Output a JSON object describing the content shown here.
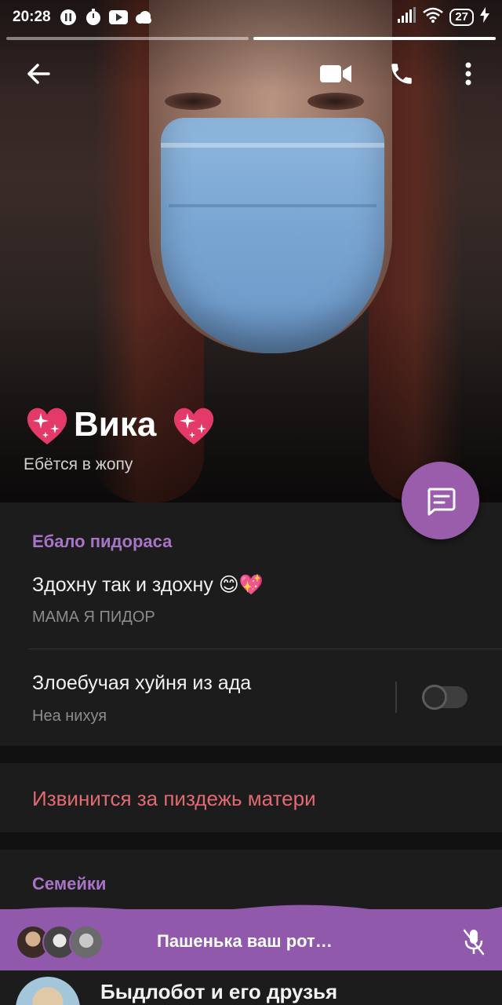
{
  "status_bar": {
    "time": "20:28",
    "battery": "27",
    "icons": [
      "pause-circle-icon",
      "timer-icon",
      "youtube-icon",
      "cloud-icon",
      "signal-icon",
      "wifi-icon",
      "battery-icon",
      "charging-icon"
    ]
  },
  "profile": {
    "name": "Вика",
    "status": "Ебётся в жопу"
  },
  "section1": {
    "title": "Ебало пидораса",
    "item1_title": "Здохну так и здохну 😊💖",
    "item1_sub": "МАМА Я ПИДОР",
    "item2_title": "Злоебучая хуйня из ада",
    "item2_sub": "Неа нихуя"
  },
  "danger_action": "Извинится за пиздежь матери",
  "section2": {
    "title": "Семейки"
  },
  "voice_chat": {
    "title": "Пашенька ваш рот…"
  },
  "list_item": {
    "title": "Быдлобот и его друзья"
  },
  "colors": {
    "accent": "#9159ab",
    "section_title": "#a874c6",
    "danger": "#e26a72",
    "background": "#1c1c1c"
  }
}
